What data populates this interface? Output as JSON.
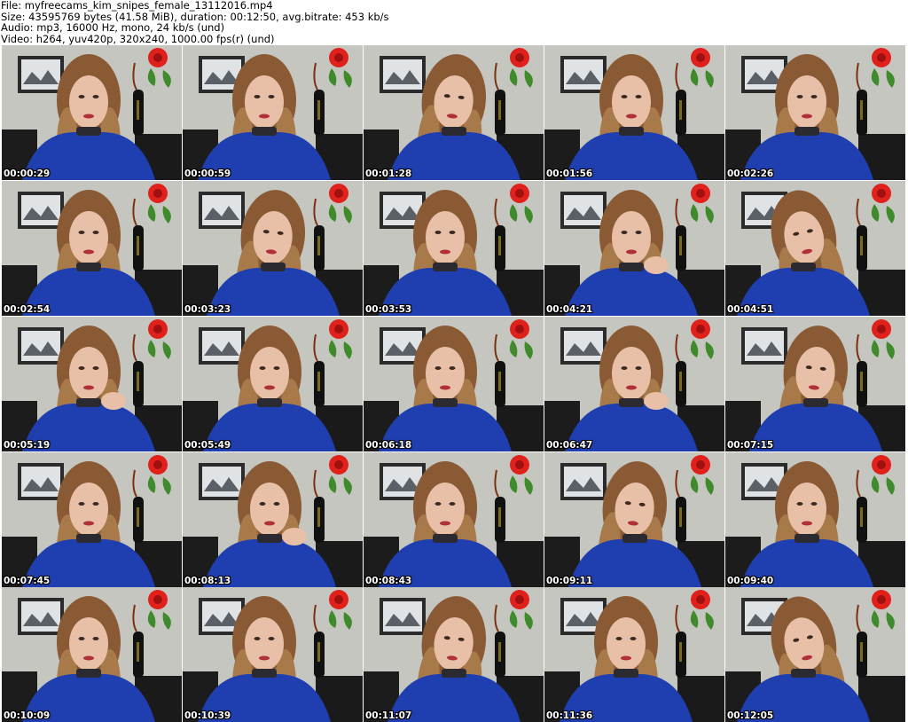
{
  "header": {
    "file_line": "File: myfreecams_kim_snipes_female_13112016.mp4",
    "size_line": "Size: 43595769 bytes (41.58 MiB), duration: 00:12:50, avg.bitrate: 453 kb/s",
    "audio_line": "Audio: mp3, 16000 Hz, mono, 24 kb/s (und)",
    "video_line": "Video: h264, yuv420p, 320x240, 1000.00 fps(r) (und)"
  },
  "thumbnails": [
    {
      "timestamp": "00:00:29"
    },
    {
      "timestamp": "00:00:59"
    },
    {
      "timestamp": "00:01:28"
    },
    {
      "timestamp": "00:01:56"
    },
    {
      "timestamp": "00:02:26"
    },
    {
      "timestamp": "00:02:54"
    },
    {
      "timestamp": "00:03:23"
    },
    {
      "timestamp": "00:03:53"
    },
    {
      "timestamp": "00:04:21"
    },
    {
      "timestamp": "00:04:51"
    },
    {
      "timestamp": "00:05:19"
    },
    {
      "timestamp": "00:05:49"
    },
    {
      "timestamp": "00:06:18"
    },
    {
      "timestamp": "00:06:47"
    },
    {
      "timestamp": "00:07:15"
    },
    {
      "timestamp": "00:07:45"
    },
    {
      "timestamp": "00:08:13"
    },
    {
      "timestamp": "00:08:43"
    },
    {
      "timestamp": "00:09:11"
    },
    {
      "timestamp": "00:09:40"
    },
    {
      "timestamp": "00:10:09"
    },
    {
      "timestamp": "00:10:39"
    },
    {
      "timestamp": "00:11:07"
    },
    {
      "timestamp": "00:11:36"
    },
    {
      "timestamp": "00:12:05"
    }
  ],
  "colors": {
    "wall": "#c4c6bf",
    "sweater": "#1f3fb0",
    "hair": "#8a5a35",
    "rose": "#e0201a",
    "timestamp_text": "#ffffff"
  }
}
